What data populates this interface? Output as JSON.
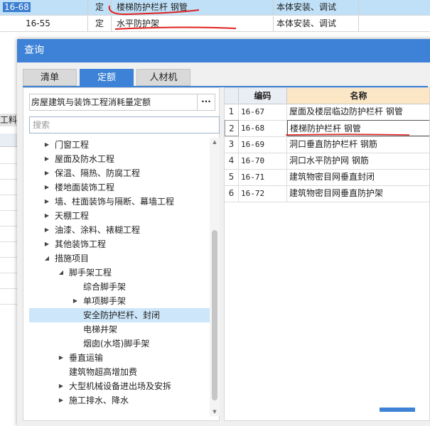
{
  "background_table": {
    "rows": [
      {
        "code": "16-68",
        "type": "定",
        "name": "楼梯防护栏杆 钢管",
        "work": "本体安装、调试",
        "selected": true
      },
      {
        "code": "16-55",
        "type": "定",
        "name": "水平防护架",
        "work": "本体安装、调试",
        "selected": false
      }
    ],
    "left_strip_label": "工料"
  },
  "dialog": {
    "title": "查询",
    "tabs": [
      {
        "label": "清单",
        "active": false
      },
      {
        "label": "定额",
        "active": true
      },
      {
        "label": "人材机",
        "active": false
      }
    ],
    "library": "房屋建筑与装饰工程消耗量定额",
    "library_more": "···",
    "search_placeholder": "搜索",
    "tree": [
      {
        "label": "门窗工程",
        "level": 1,
        "arrow": "collapsed"
      },
      {
        "label": "屋面及防水工程",
        "level": 1,
        "arrow": "collapsed"
      },
      {
        "label": "保温、隔热、防腐工程",
        "level": 1,
        "arrow": "collapsed"
      },
      {
        "label": "楼地面装饰工程",
        "level": 1,
        "arrow": "collapsed"
      },
      {
        "label": "墙、柱面装饰与隔断、幕墙工程",
        "level": 1,
        "arrow": "collapsed"
      },
      {
        "label": "天棚工程",
        "level": 1,
        "arrow": "collapsed"
      },
      {
        "label": "油漆、涂料、裱糊工程",
        "level": 1,
        "arrow": "collapsed"
      },
      {
        "label": "其他装饰工程",
        "level": 1,
        "arrow": "collapsed"
      },
      {
        "label": "措施项目",
        "level": 1,
        "arrow": "expanded"
      },
      {
        "label": "脚手架工程",
        "level": 2,
        "arrow": "expanded"
      },
      {
        "label": "综合脚手架",
        "level": 3,
        "arrow": "none"
      },
      {
        "label": "单项脚手架",
        "level": 3,
        "arrow": "collapsed"
      },
      {
        "label": "安全防护栏杆、封闭",
        "level": 3,
        "arrow": "none",
        "selected": true
      },
      {
        "label": "电梯井架",
        "level": 3,
        "arrow": "none"
      },
      {
        "label": "烟囱(水塔)脚手架",
        "level": 3,
        "arrow": "none"
      },
      {
        "label": "垂直运输",
        "level": 2,
        "arrow": "collapsed"
      },
      {
        "label": "建筑物超高增加费",
        "level": 2,
        "arrow": "none"
      },
      {
        "label": "大型机械设备进出场及安拆",
        "level": 2,
        "arrow": "collapsed"
      },
      {
        "label": "施工排水、降水",
        "level": 2,
        "arrow": "collapsed"
      }
    ],
    "result_headers": {
      "idx": "",
      "code": "编码",
      "name": "名称"
    },
    "results": [
      {
        "idx": "1",
        "code": "16-67",
        "name": "屋面及楼层临边防护栏杆 钢管"
      },
      {
        "idx": "2",
        "code": "16-68",
        "name": "楼梯防护栏杆 钢管",
        "selected": true
      },
      {
        "idx": "3",
        "code": "16-69",
        "name": "洞口垂直防护栏杆 钢筋"
      },
      {
        "idx": "4",
        "code": "16-70",
        "name": "洞口水平防护网 钢筋"
      },
      {
        "idx": "5",
        "code": "16-71",
        "name": "建筑物密目网垂直封闭"
      },
      {
        "idx": "6",
        "code": "16-72",
        "name": "建筑物密目网垂直防护架"
      }
    ]
  },
  "colors": {
    "accent": "#3d82d6",
    "selection": "#cde6f9",
    "annotation": "#e02020"
  }
}
